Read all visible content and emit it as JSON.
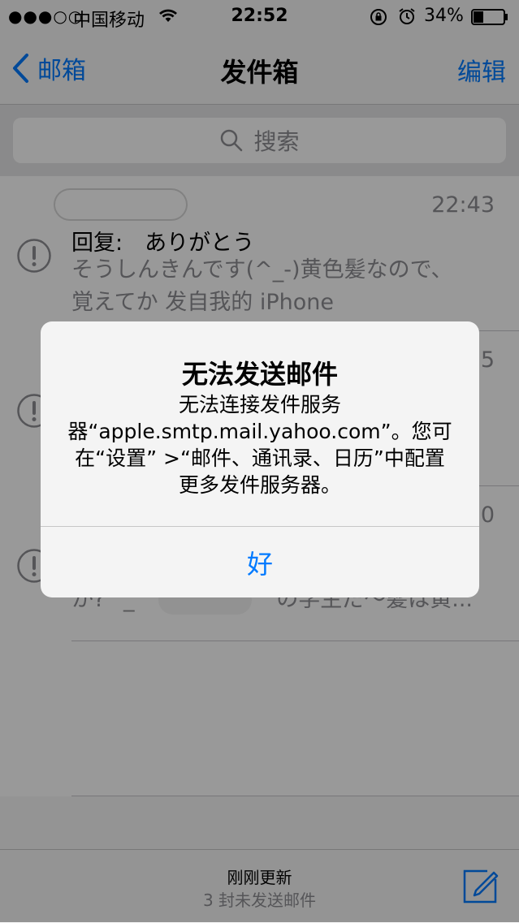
{
  "status_bar": {
    "signal": "●●●○○",
    "carrier": "中国移动",
    "time": "22:52",
    "battery": "34%",
    "icons": [
      "wifi-icon",
      "rotation-lock-icon",
      "alarm-icon",
      "battery-icon"
    ]
  },
  "nav": {
    "back_label": "邮箱",
    "title": "发件箱",
    "edit_label": "编辑"
  },
  "search": {
    "placeholder": "搜索"
  },
  "mail_items": [
    {
      "time": "22:43",
      "subject": "回复:　ありがとう",
      "preview_lines": [
        "そうしんきんです(^_-)黄色髪なので、",
        "覚えてか 发自我的 iPhone"
      ]
    },
    {
      "time": "22:35",
      "subject": "",
      "preview_lines": []
    },
    {
      "time": "22:30",
      "subject": "",
      "preview_lines": [
        "か?^_^",
        "の学生だ〜髪は黄..."
      ]
    }
  ],
  "alert": {
    "title": "无法发送邮件",
    "message_lines": [
      "无法连接发件服务",
      "器“apple.smtp.mail.yahoo.com”。您可",
      "在“设置” >“邮件、通讯录、日历”中配置",
      "更多发件服务器。"
    ],
    "ok_label": "好"
  },
  "toolbar": {
    "status_main": "刚刚更新",
    "status_sub": "3 封未发送邮件"
  },
  "colors": {
    "accent": "#007aff",
    "secondary_text": "#8e8e93",
    "overlay": "rgba(0,0,0,0.4)"
  }
}
